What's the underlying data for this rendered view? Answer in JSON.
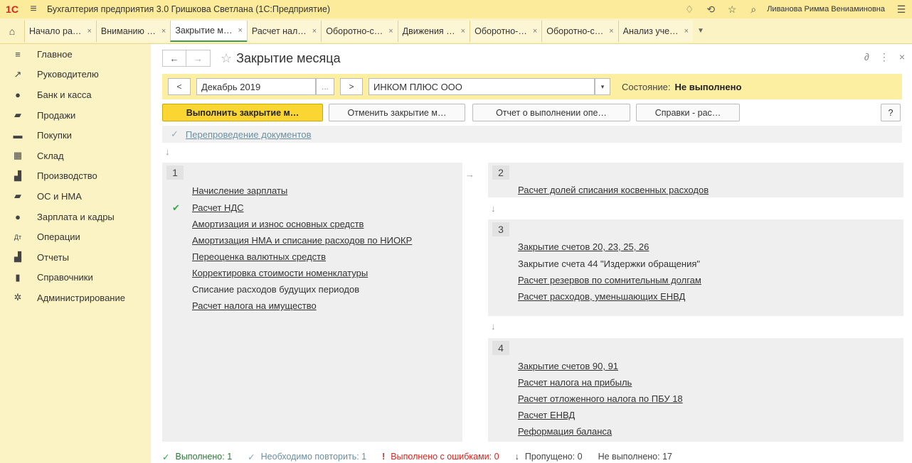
{
  "app": {
    "title": "Бухгалтерия предприятия 3.0 Гришкова Светлана  (1С:Предприятие)",
    "user": "Ливанова Римма Вениаминовна",
    "logo_text": "1С"
  },
  "tabs": [
    {
      "label": "Начало ра…"
    },
    {
      "label": "Вниманию …"
    },
    {
      "label": "Закрытие м…"
    },
    {
      "label": "Расчет нал…"
    },
    {
      "label": "Оборотно-с…"
    },
    {
      "label": "Движения …"
    },
    {
      "label": "Оборотно-…"
    },
    {
      "label": "Оборотно-с…"
    },
    {
      "label": "Анализ уче…"
    }
  ],
  "sidebar": {
    "items": [
      {
        "label": "Главное",
        "icon": "menu-icon"
      },
      {
        "label": "Руководителю",
        "icon": "chart-line-icon"
      },
      {
        "label": "Банк и касса",
        "icon": "bank-icon"
      },
      {
        "label": "Продажи",
        "icon": "sales-icon"
      },
      {
        "label": "Покупки",
        "icon": "cart-icon"
      },
      {
        "label": "Склад",
        "icon": "warehouse-icon"
      },
      {
        "label": "Производство",
        "icon": "factory-icon"
      },
      {
        "label": "ОС и НМА",
        "icon": "truck-icon"
      },
      {
        "label": "Зарплата и кадры",
        "icon": "person-icon"
      },
      {
        "label": "Операции",
        "icon": "operations-icon"
      },
      {
        "label": "Отчеты",
        "icon": "bar-chart-icon"
      },
      {
        "label": "Справочники",
        "icon": "book-icon"
      },
      {
        "label": "Администрирование",
        "icon": "gear-icon"
      }
    ]
  },
  "page": {
    "title": "Закрытие месяца"
  },
  "filter": {
    "prev_label": "<",
    "period": "Декабрь 2019",
    "ellipsis": "...",
    "next_label": ">",
    "organization": "ИНКОМ ПЛЮС ООО",
    "status_label": "Состояние:",
    "status_value": "Не выполнено"
  },
  "actions": {
    "execute": "Выполнить закрытие м…",
    "cancel": "Отменить закрытие м…",
    "report": "Отчет о выполнении опе…",
    "certificates": "Справки - рас…",
    "help": "?"
  },
  "reprocess": {
    "label": "Перепроведение документов"
  },
  "blocks": {
    "b1": {
      "num": "1",
      "ops": [
        "Начисление зарплаты",
        "Расчет НДС",
        "Амортизация и износ основных средств",
        "Амортизация НМА и списание расходов по НИОКР",
        "Переоценка валютных средств",
        "Корректировка стоимости номенклатуры",
        "Списание расходов будущих периодов",
        "Расчет налога на имущество"
      ]
    },
    "b2": {
      "num": "2",
      "ops": [
        "Расчет долей списания косвенных расходов"
      ]
    },
    "b3": {
      "num": "3",
      "ops": [
        "Закрытие счетов 20, 23, 25, 26",
        "Закрытие счета 44 \"Издержки обращения\"",
        "Расчет резервов по сомнительным долгам",
        "Расчет расходов, уменьшающих ЕНВД"
      ]
    },
    "b4": {
      "num": "4",
      "ops": [
        "Закрытие счетов 90, 91",
        "Расчет налога на прибыль",
        "Расчет отложенного налога по ПБУ 18",
        "Расчет ЕНВД",
        "Реформация баланса"
      ]
    }
  },
  "footer": {
    "done_label": "Выполнено:",
    "done_count": "1",
    "repeat_label": "Необходимо повторить:",
    "repeat_count": "1",
    "errors_label": "Выполнено с ошибками:",
    "errors_count": "0",
    "skipped_label": "Пропущено:",
    "skipped_count": "0",
    "notdone_label": "Не выполнено:",
    "notdone_count": "17"
  },
  "colors": {
    "accent_yellow": "#fbd632",
    "panel_yellow": "#fbf3c4",
    "ok_green": "#3fa04a",
    "error_red": "#d6271f"
  }
}
